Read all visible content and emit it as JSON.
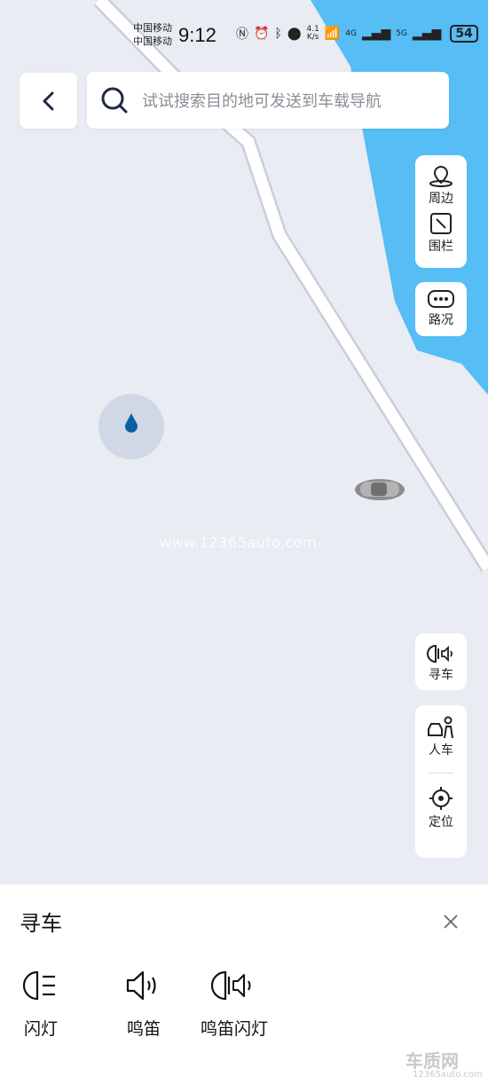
{
  "status": {
    "carrier1": "中国移动",
    "carrier2": "中国移动",
    "time": "9:12",
    "net_speed_value": "4.1",
    "net_speed_unit": "K/s",
    "net1": "4G",
    "net2": "5G",
    "battery": "54"
  },
  "search": {
    "placeholder": "试试搜索目的地可发送到车载导航"
  },
  "side": {
    "nearby": "周边",
    "fence": "围栏",
    "traffic": "路况",
    "find_car": "寻车",
    "person_car": "人车",
    "locate": "定位"
  },
  "map": {
    "watermark": "www.12365auto.com",
    "water_color": "#56bdf5",
    "land_color": "#e9ecf3",
    "road_color": "#ffffff"
  },
  "panel": {
    "title": "寻车",
    "actions": [
      {
        "label": "闪灯",
        "icon": "headlight-icon"
      },
      {
        "label": "鸣笛",
        "icon": "horn-icon"
      },
      {
        "label": "鸣笛闪灯",
        "icon": "horn-flash-icon"
      }
    ]
  },
  "brand": {
    "name": "车质网",
    "site": "12365auto.com"
  }
}
